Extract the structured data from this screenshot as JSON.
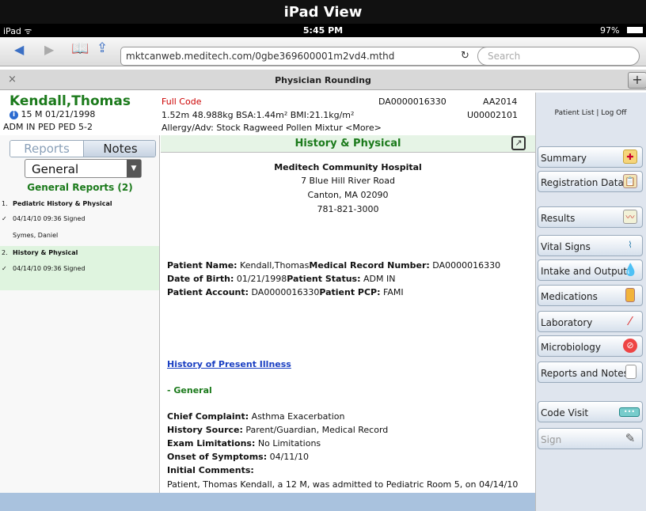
{
  "banner": "iPad View",
  "status": {
    "device": "iPad ",
    "wifi": "ᯤ",
    "time": "5:45 PM",
    "battery": "97%"
  },
  "browser": {
    "url": "mktcanweb.meditech.com/0gbe369600001m2vd4.mthd",
    "search_placeholder": "Search"
  },
  "tab": {
    "title": "Physician Rounding",
    "close": "×",
    "plus": "+"
  },
  "patient": {
    "name": "Kendall,Thomas",
    "demo": "15 M 01/21/1998",
    "adm": "ADM IN PED PED 5-2",
    "code": "Full Code",
    "measures": "1.52m 48.988kg BSA:1.44m² BMI:21.1kg/m²",
    "allergy": "Allergy/Adv: Stock Ragweed Pollen Mixtur <More>",
    "acct": "DA0000016330",
    "aa": "AA2014",
    "unit": "U00002101"
  },
  "sidebar": {
    "links": "Patient List | Log Off",
    "buttons": [
      "Summary",
      "Registration Data",
      "Results",
      "Vital Signs",
      "Intake and Output",
      "Medications",
      "Laboratory",
      "Microbiology",
      "Reports and Notes",
      "Code Visit",
      "Sign"
    ]
  },
  "left": {
    "seg_reports": "Reports",
    "seg_notes": "Notes",
    "dropdown": "General",
    "heading": "General Reports (2)",
    "reports": [
      {
        "num": "1.",
        "title": "Pediatric History & Physical",
        "date": "04/14/10 09:36 Signed",
        "author": "Symes, Daniel"
      },
      {
        "num": "2.",
        "title": "History & Physical",
        "date": "04/14/10 09:36 Signed"
      }
    ]
  },
  "doc": {
    "title": "History & Physical",
    "hosp": "Meditech Community Hospital",
    "addr1": "7 Blue Hill River Road",
    "addr2": "Canton, MA 02090",
    "phone": "781-821-3000",
    "l1a": "Patient Name:",
    "l1b": " Kendall,Thomas",
    "l1c": "Medical Record Number:",
    "l1d": " DA0000016330",
    "l2a": "Date of Birth:",
    "l2b": " 01/21/1998",
    "l2c": "Patient Status:",
    "l2d": " ADM IN",
    "l3a": "Patient Account:",
    "l3b": " DA0000016330",
    "l3c": "Patient PCP:",
    "l3d": " FAMI",
    "hpi": "History of Present Illness",
    "general": "- General",
    "cc_l": "Chief Complaint:",
    "cc_v": " Asthma Exacerbation",
    "hs_l": "History Source:",
    "hs_v": " Parent/Guardian, Medical Record",
    "el_l": "Exam Limitations:",
    "el_v": " No Limitations",
    "os_l": "Onset of Symptoms:",
    "os_v": " 04/11/10",
    "ic_l": "Initial Comments:",
    "ic_v": "Patient, Thomas Kendall, a 12 M, was admitted to Pediatric Room 5, on 04/14/10"
  }
}
